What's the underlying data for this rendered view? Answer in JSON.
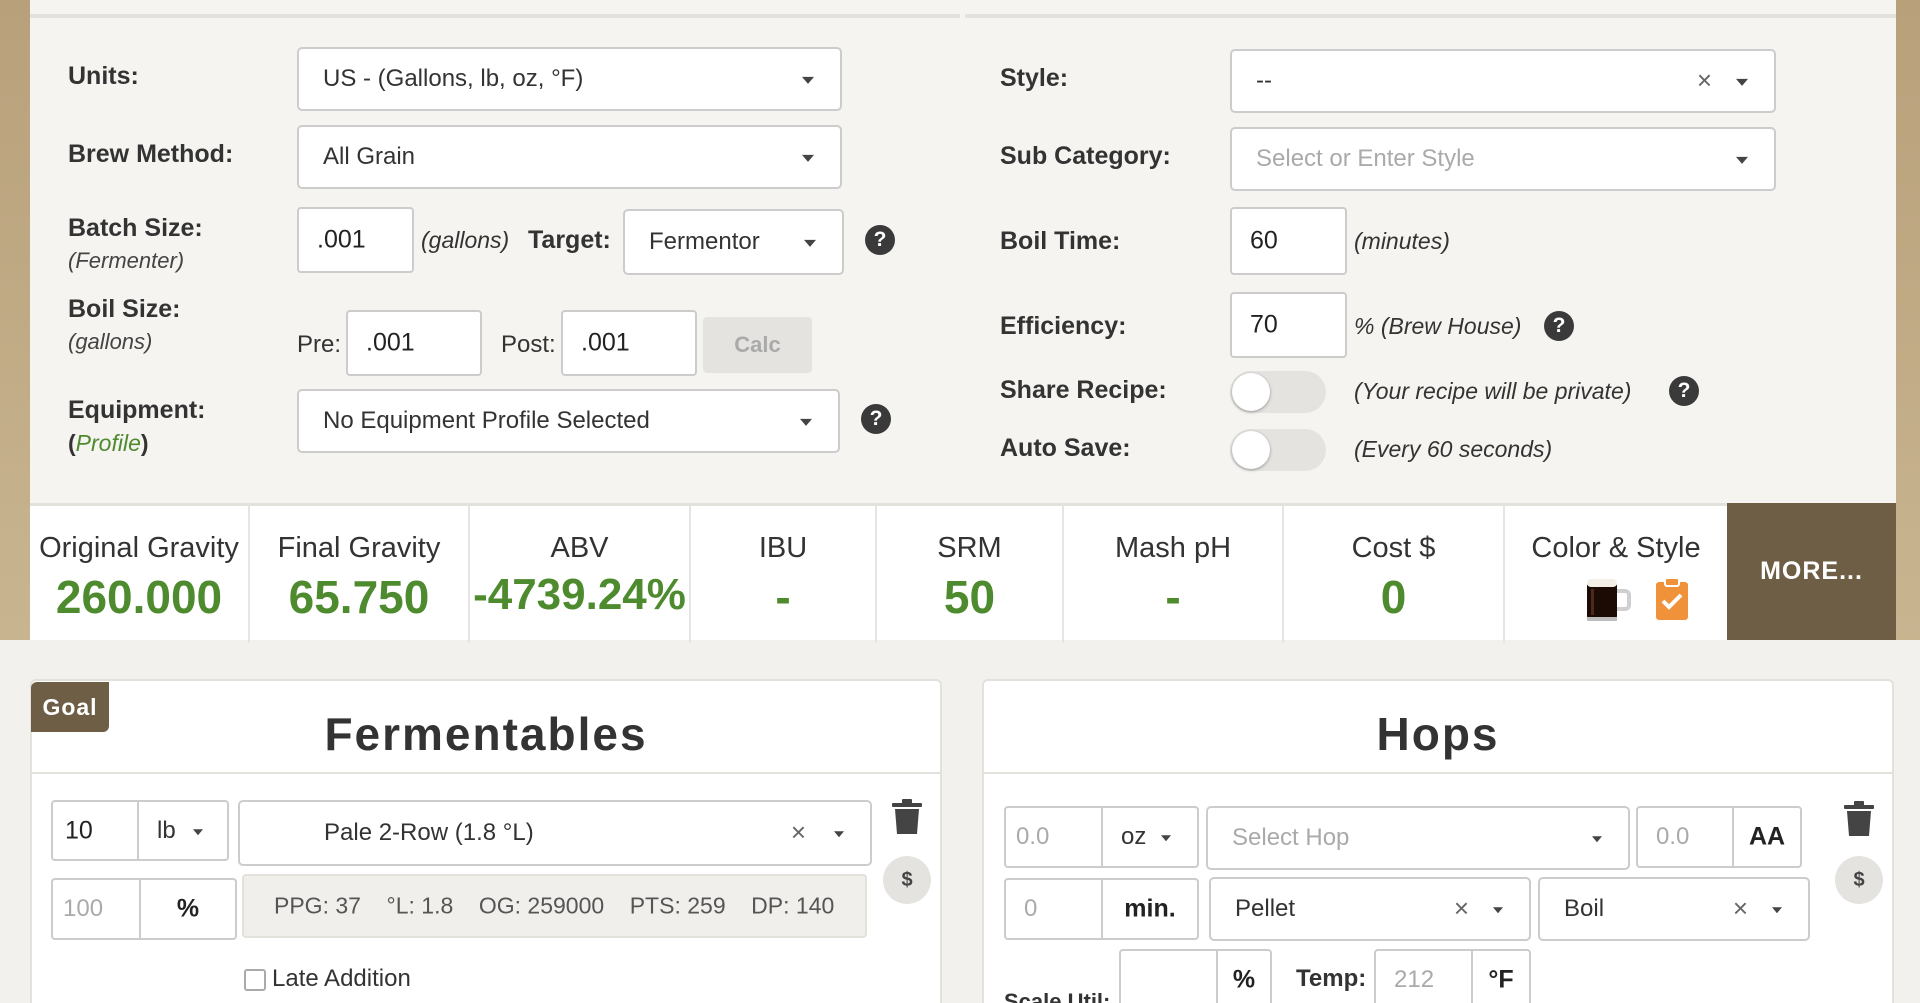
{
  "settings": {
    "units": {
      "label": "Units:",
      "value": "US - (Gallons, lb, oz, °F)"
    },
    "brew_method": {
      "label": "Brew Method:",
      "value": "All Grain"
    },
    "batch_size": {
      "label": "Batch Size:",
      "sublabel": "(Fermenter)",
      "value": ".001",
      "unit": "(gallons)",
      "target_label": "Target:",
      "target_value": "Fermentor"
    },
    "boil_size": {
      "label": "Boil Size:",
      "sublabel": "(gallons)",
      "pre_label": "Pre:",
      "pre_value": ".001",
      "post_label": "Post:",
      "post_value": ".001",
      "calc_label": "Calc"
    },
    "equipment": {
      "label": "Equipment:",
      "sublabel_open": "(",
      "sublabel_link": "Profile",
      "sublabel_close": ")",
      "value": "No Equipment Profile Selected"
    },
    "style": {
      "label": "Style:",
      "value": "--"
    },
    "sub_category": {
      "label": "Sub Category:",
      "placeholder": "Select or Enter Style"
    },
    "boil_time": {
      "label": "Boil Time:",
      "value": "60",
      "unit": "(minutes)"
    },
    "efficiency": {
      "label": "Efficiency:",
      "value": "70",
      "unit": "% (Brew House)"
    },
    "share_recipe": {
      "label": "Share Recipe:",
      "note": "(Your recipe will be private)",
      "on": false
    },
    "auto_save": {
      "label": "Auto Save:",
      "note": "(Every 60 seconds)",
      "on": false
    },
    "help_glyph": "?",
    "clear_glyph": "×"
  },
  "stats": [
    {
      "label": "Original Gravity",
      "value": "260.000"
    },
    {
      "label": "Final Gravity",
      "value": "65.750"
    },
    {
      "label": "ABV",
      "value": "-4739.24%"
    },
    {
      "label": "IBU",
      "value": "-"
    },
    {
      "label": "SRM",
      "value": "50"
    },
    {
      "label": "Mash pH",
      "value": "-"
    },
    {
      "label": "Cost $",
      "value": "0"
    },
    {
      "label": "Color & Style",
      "value": ""
    }
  ],
  "more_label": "MORE...",
  "colors": {
    "stat_value": "#4e8a2e",
    "accent_brown": "#6e5e45",
    "style_badge": "#f0923a",
    "beer_color": "#1c0a05"
  },
  "fermentables": {
    "goal_tag": "Goal",
    "title": "Fermentables",
    "amount": "10",
    "unit": "lb",
    "grain": "Pale 2-Row (1.8 °L)",
    "percent_value": "100",
    "percent_symbol": "%",
    "dollar": "$",
    "stats": [
      {
        "k": "PPG:",
        "v": "37"
      },
      {
        "k": "°L:",
        "v": "1.8"
      },
      {
        "k": "OG:",
        "v": "259000"
      },
      {
        "k": "PTS:",
        "v": "259"
      },
      {
        "k": "DP:",
        "v": "140"
      }
    ],
    "late_addition": "Late Addition"
  },
  "hops": {
    "title": "Hops",
    "amount_placeholder": "0.0",
    "unit": "oz",
    "hop_placeholder": "Select Hop",
    "aa_placeholder": "0.0",
    "aa_label": "AA",
    "time_placeholder": "0",
    "time_unit": "min.",
    "form": "Pellet",
    "use": "Boil",
    "dollar": "$",
    "scale_label": "Scale Util:",
    "percent_symbol": "%",
    "temp_label": "Temp:",
    "temp_placeholder": "212",
    "temp_unit": "°F"
  }
}
